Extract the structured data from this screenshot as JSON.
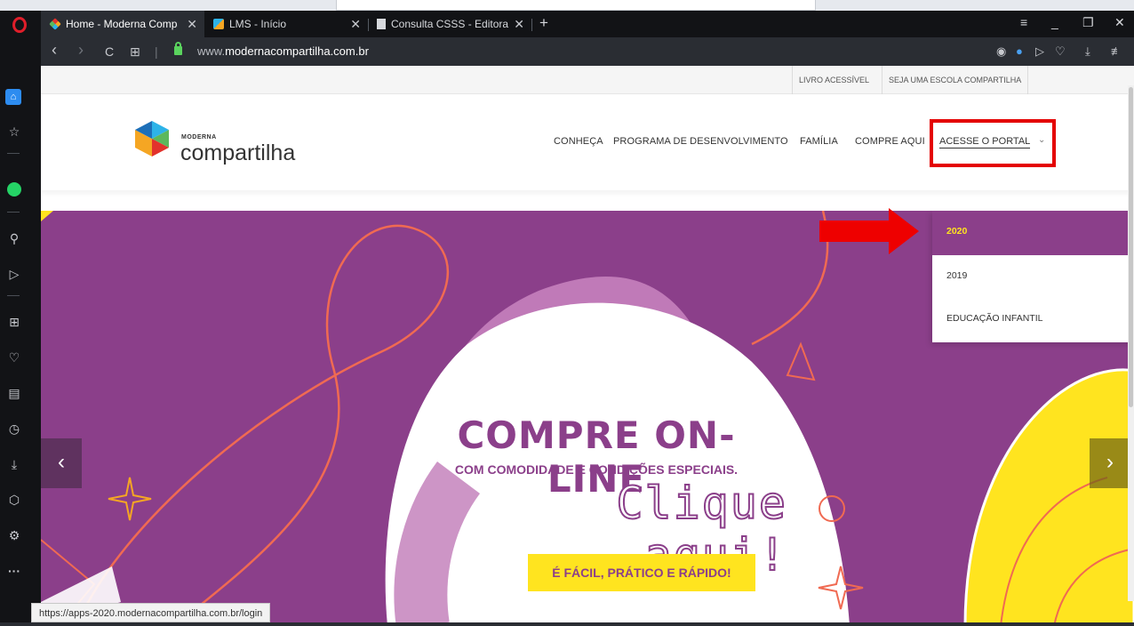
{
  "browser": {
    "tabs": [
      {
        "label": "Home - Moderna Compartilha",
        "close": "✕",
        "active": true
      },
      {
        "label": "LMS - Início",
        "close": "✕",
        "active": false
      },
      {
        "label": "Consulta CSSS - Editora Moderna",
        "close": "✕",
        "active": false
      }
    ],
    "new_tab": "+",
    "window_controls": {
      "menu": "≡",
      "minimize": "_",
      "maximize": "❐",
      "close": "✕"
    },
    "nav": {
      "back": "‹",
      "forward": "›",
      "reload": "C",
      "tabs_grid": "⊞",
      "separator": "|"
    },
    "url_domain": "www.",
    "url_main": "modernacompartilha.com.br",
    "address_icons": {
      "camera": "◉",
      "shield": "●",
      "send": "▷",
      "heart": "♡",
      "download": "⤓",
      "settings": "≢"
    },
    "sidebar_icons": {
      "home": "⌂",
      "bookmark": "☆",
      "search": "⚲",
      "send": "▷",
      "speed_dial": "⊞",
      "heart": "♡",
      "news": "▤",
      "history": "◷",
      "download": "⤓",
      "box": "⬡",
      "settings": "⚙",
      "more": "···"
    },
    "status_url": "https://apps-2020.modernacompartilha.com.br/login"
  },
  "site": {
    "topbar_links": [
      "LIVRO ACESSÍVEL",
      "SEJA UMA ESCOLA COMPARTILHA"
    ],
    "logo_small": "MODERNA",
    "logo_big": "compartilha",
    "menu": [
      "CONHEÇA",
      "PROGRAMA DE DESENVOLVIMENTO",
      "FAMÍLIA",
      "COMPRE AQUI"
    ],
    "portal_label": "ACESSE O PORTAL",
    "portal_chevron": "⌄",
    "dropdown": [
      {
        "label": "2020",
        "active": true
      },
      {
        "label": "2019",
        "active": false
      },
      {
        "label": "EDUCAÇÃO INFANTIL",
        "active": false
      }
    ],
    "hero": {
      "headline": "COMPRE ON-LINE",
      "subheadline": "COM COMODIDADE E CONDIÇÕES ESPECIAIS.",
      "cta": "Clique aqui!",
      "tagline": "É FÁCIL, PRÁTICO E RÁPIDO!",
      "prev": "‹",
      "next": "›"
    }
  },
  "colors": {
    "purple": "#8b3f8a",
    "yellow": "#ffe41f",
    "highlight_red": "#e40000"
  }
}
